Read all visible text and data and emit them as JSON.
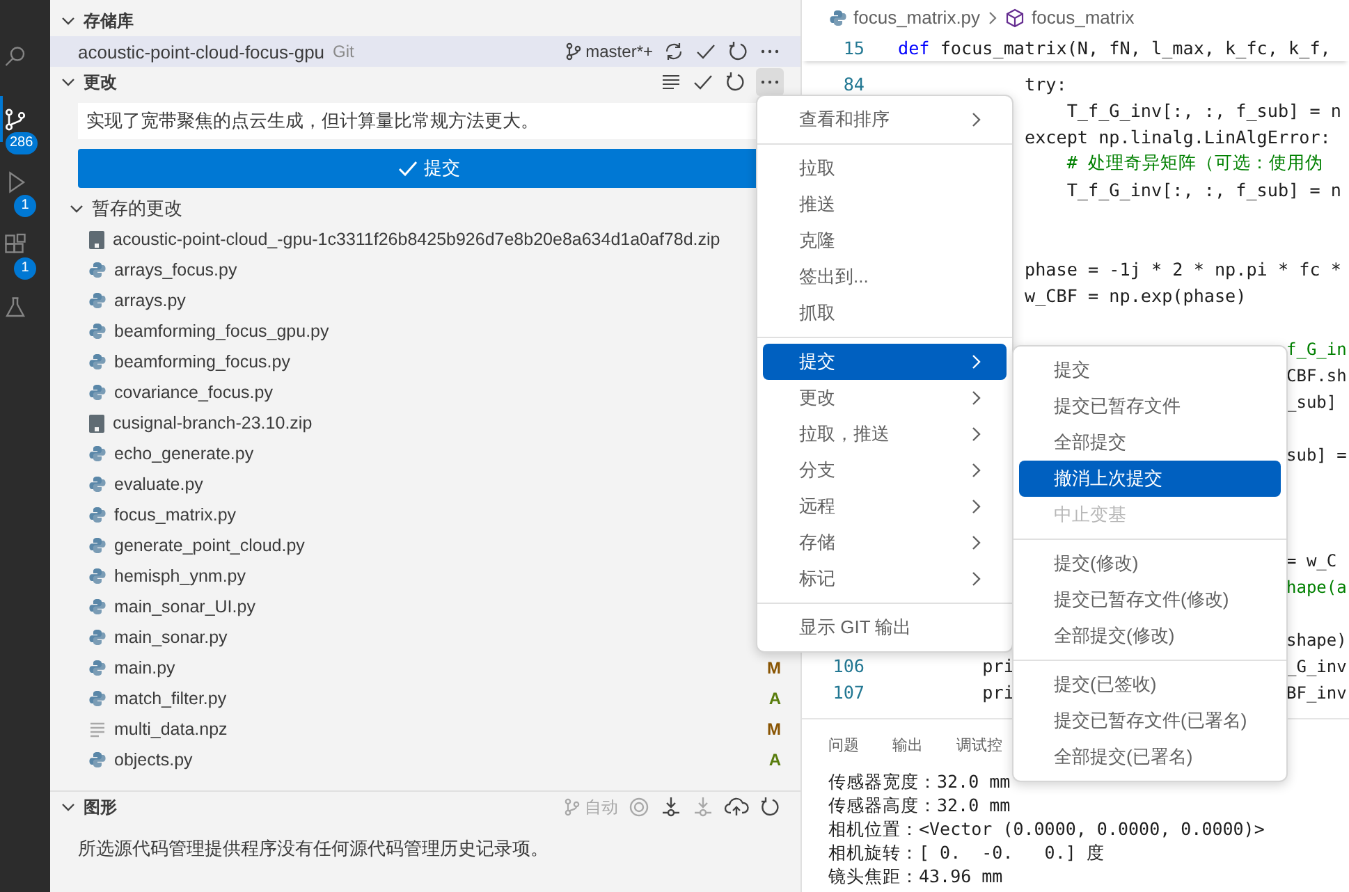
{
  "activity_bar": {
    "items": [
      {
        "kind": "search",
        "selected": false
      },
      {
        "kind": "source_control",
        "selected": true,
        "badge": "286"
      },
      {
        "kind": "run",
        "selected": false,
        "badge": "1"
      },
      {
        "kind": "extensions",
        "selected": false,
        "badge": "1"
      },
      {
        "kind": "testing",
        "selected": false
      }
    ]
  },
  "scm": {
    "repositories_title": "存储库",
    "repository": {
      "name": "acoustic-point-cloud-focus-gpu",
      "provider": "Git",
      "branch": "master*+"
    },
    "changes_title": "更改",
    "commit_message": "实现了宽带聚焦的点云生成，但计算量比常规方法更大。",
    "commit_button": "提交",
    "staged": {
      "title": "暂存的更改",
      "files": [
        {
          "name": "acoustic-point-cloud_-gpu-1c3311f26b8425b926d7e8b20e8a634d1a0af78d.zip",
          "kind": "zip"
        },
        {
          "name": "arrays_focus.py",
          "kind": "python"
        },
        {
          "name": "arrays.py",
          "kind": "python"
        },
        {
          "name": "beamforming_focus_gpu.py",
          "kind": "python"
        },
        {
          "name": "beamforming_focus.py",
          "kind": "python"
        },
        {
          "name": "covariance_focus.py",
          "kind": "python"
        },
        {
          "name": "cusignal-branch-23.10.zip",
          "kind": "zip"
        },
        {
          "name": "echo_generate.py",
          "kind": "python"
        },
        {
          "name": "evaluate.py",
          "kind": "python"
        },
        {
          "name": "focus_matrix.py",
          "kind": "python"
        },
        {
          "name": "generate_point_cloud.py",
          "kind": "python"
        },
        {
          "name": "hemisph_ynm.py",
          "kind": "python"
        },
        {
          "name": "main_sonar_UI.py",
          "kind": "python"
        },
        {
          "name": "main_sonar.py",
          "kind": "python"
        },
        {
          "name": "main.py",
          "kind": "python",
          "status": "M"
        },
        {
          "name": "match_filter.py",
          "kind": "python",
          "status": "A"
        },
        {
          "name": "multi_data.npz",
          "kind": "text",
          "status": "M"
        },
        {
          "name": "objects.py",
          "kind": "python",
          "status": "A"
        }
      ]
    }
  },
  "graph": {
    "title": "图形",
    "auto_label": "自动",
    "message": "所选源代码管理提供程序没有任何源代码管理历史记录项。"
  },
  "editor": {
    "breadcrumb": [
      "focus_matrix.py",
      "focus_matrix"
    ],
    "sticky_line": {
      "number": "15",
      "keyword": "def",
      "text": "focus_matrix(N, fN, l_max, k_fc, k_f,"
    },
    "lines": [
      {
        "number": "84",
        "kind": "code",
        "text": "            try:"
      },
      {
        "kind": "code",
        "text": "                T_f_G_inv[:, :, f_sub] = n"
      },
      {
        "kind": "code",
        "text": "            except np.linalg.LinAlgError:"
      },
      {
        "kind": "comment",
        "text": "                # 处理奇异矩阵（可选：使用伪"
      },
      {
        "kind": "code",
        "text": "                T_f_G_inv[:, :, f_sub] = n"
      },
      {
        "kind": "blank"
      },
      {
        "kind": "blank"
      },
      {
        "kind": "code",
        "text": "            phase = -1j * 2 * np.pi * fc *"
      },
      {
        "kind": "code",
        "text": "            w_CBF = np.exp(phase)"
      },
      {
        "kind": "blank"
      },
      {
        "kind": "comment",
        "tail": "f_G_in"
      },
      {
        "kind": "code",
        "tail": "CBF.sh"
      },
      {
        "kind": "code",
        "tail": "_sub]"
      },
      {
        "kind": "blank"
      },
      {
        "kind": "code",
        "tail": "sub] ="
      },
      {
        "kind": "blank"
      },
      {
        "kind": "blank"
      },
      {
        "kind": "blank"
      },
      {
        "kind": "code",
        "tail": "= w_C"
      },
      {
        "kind": "comment",
        "tail": "hape(a"
      },
      {
        "kind": "blank"
      },
      {
        "kind": "code",
        "tail": "shape)"
      },
      {
        "number": "106",
        "kind": "code",
        "text": "        pri",
        "tail": "_G_inv"
      },
      {
        "number": "107",
        "kind": "code",
        "text": "        pri",
        "tail": "BF_inv"
      }
    ]
  },
  "panel": {
    "tabs": [
      "问题",
      "输出",
      "调试控"
    ],
    "lines": [
      "传感器宽度：32.0 mm",
      "传感器高度：32.0 mm",
      "相机位置：<Vector (0.0000, 0.0000, 0.0000)>",
      "相机旋转：[ 0.  -0.   0.] 度",
      "镜头焦距：43.96 mm"
    ]
  },
  "context_menu": {
    "groups": [
      [
        {
          "label": "查看和排序",
          "has_submenu": true,
          "selected": false
        }
      ],
      [
        {
          "label": "拉取",
          "has_submenu": false,
          "selected": false
        },
        {
          "label": "推送",
          "has_submenu": false,
          "selected": false
        },
        {
          "label": "克隆",
          "has_submenu": false,
          "selected": false
        },
        {
          "label": "签出到...",
          "has_submenu": false,
          "selected": false
        },
        {
          "label": "抓取",
          "has_submenu": false,
          "selected": false
        }
      ],
      [
        {
          "label": "提交",
          "has_submenu": true,
          "selected": true
        },
        {
          "label": "更改",
          "has_submenu": true,
          "selected": false
        },
        {
          "label": "拉取，推送",
          "has_submenu": true,
          "selected": false
        },
        {
          "label": "分支",
          "has_submenu": true,
          "selected": false
        },
        {
          "label": "远程",
          "has_submenu": true,
          "selected": false
        },
        {
          "label": "存储",
          "has_submenu": true,
          "selected": false
        },
        {
          "label": "标记",
          "has_submenu": true,
          "selected": false
        }
      ],
      [
        {
          "label": "显示 GIT 输出",
          "has_submenu": false,
          "selected": false
        }
      ]
    ]
  },
  "submenu": {
    "groups": [
      [
        {
          "label": "提交",
          "selected": false,
          "disabled": false
        },
        {
          "label": "提交已暂存文件",
          "selected": false,
          "disabled": false
        },
        {
          "label": "全部提交",
          "selected": false,
          "disabled": false
        },
        {
          "label": "撤消上次提交",
          "selected": true,
          "disabled": false
        },
        {
          "label": "中止变基",
          "selected": false,
          "disabled": true
        }
      ],
      [
        {
          "label": "提交(修改)",
          "selected": false,
          "disabled": false
        },
        {
          "label": "提交已暂存文件(修改)",
          "selected": false,
          "disabled": false
        },
        {
          "label": "全部提交(修改)",
          "selected": false,
          "disabled": false
        }
      ],
      [
        {
          "label": "提交(已签收)",
          "selected": false,
          "disabled": false
        },
        {
          "label": "提交已暂存文件(已署名)",
          "selected": false,
          "disabled": false
        },
        {
          "label": "全部提交(已署名)",
          "selected": false,
          "disabled": false
        }
      ]
    ]
  }
}
